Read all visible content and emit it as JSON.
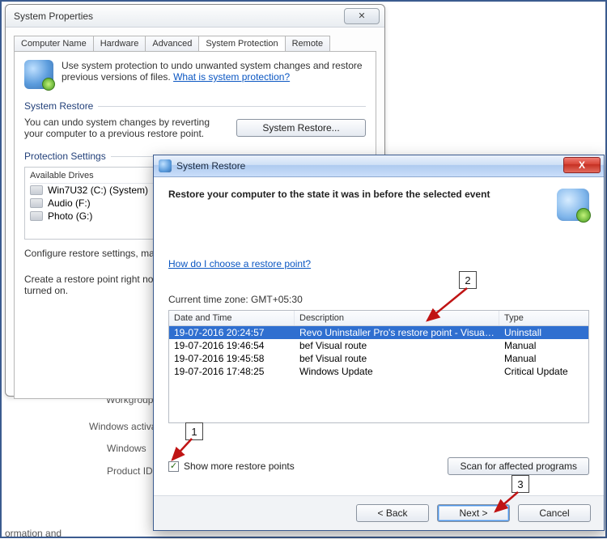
{
  "sysprop": {
    "title": "System Properties",
    "close_glyph": "✕",
    "tabs": [
      "Computer Name",
      "Hardware",
      "Advanced",
      "System Protection",
      "Remote"
    ],
    "active_tab_index": 3,
    "intro_text": "Use system protection to undo unwanted system changes and restore previous versions of files. ",
    "intro_link": "What is system protection?",
    "group_restore": "System Restore",
    "restore_desc": "You can undo system changes by reverting your computer to a previous restore point.",
    "restore_btn": "System Restore...",
    "group_protection": "Protection Settings",
    "drives_header": "Available Drives",
    "drives": [
      "Win7U32 (C:) (System)",
      "Audio (F:)",
      "Photo (G:)"
    ],
    "configure_text": "Configure restore settings, manage disk space, and delete restore points.",
    "create_text": "Create a restore point right now for the drives that have system protection turned on."
  },
  "bg_labels": {
    "workgroup": "Workgroup:",
    "activation": "Windows activation",
    "windows": "Windows",
    "productid": "Product ID",
    "bottom": "ormation and"
  },
  "sr": {
    "title": "System Restore",
    "close_glyph": "X",
    "heading": "Restore your computer to the state it was in before the selected event",
    "help_link": "How do I choose a restore point?",
    "tz_label": "Current time zone: GMT+05:30",
    "cols": {
      "date": "Date and Time",
      "desc": "Description",
      "type": "Type"
    },
    "rows": [
      {
        "date": "19-07-2016 20:24:57",
        "desc": "Revo Uninstaller Pro's restore point - VisualRout...",
        "type": "Uninstall",
        "selected": true
      },
      {
        "date": "19-07-2016 19:46:54",
        "desc": "bef Visual route",
        "type": "Manual",
        "selected": false
      },
      {
        "date": "19-07-2016 19:45:58",
        "desc": "bef Visual route",
        "type": "Manual",
        "selected": false
      },
      {
        "date": "19-07-2016 17:48:25",
        "desc": "Windows Update",
        "type": "Critical Update",
        "selected": false
      }
    ],
    "show_more_label": "Show more restore points",
    "show_more_checked": true,
    "scan_btn": "Scan for affected programs",
    "back_btn": "< Back",
    "next_btn": "Next >",
    "cancel_btn": "Cancel"
  },
  "callouts": {
    "c1": "1",
    "c2": "2",
    "c3": "3"
  }
}
